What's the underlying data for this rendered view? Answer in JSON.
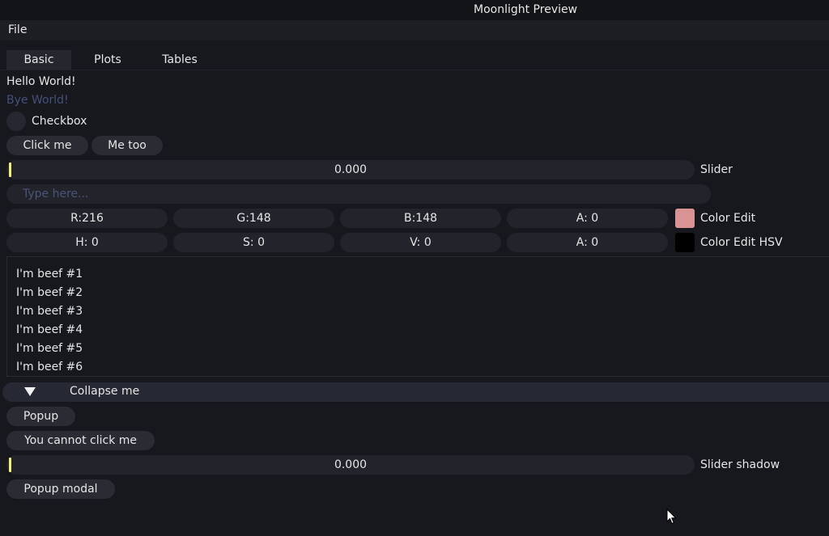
{
  "window": {
    "title": "Moonlight Preview"
  },
  "menubar": {
    "items": [
      "File"
    ]
  },
  "tabs": [
    "Basic",
    "Plots",
    "Tables"
  ],
  "basic": {
    "hello": "Hello World!",
    "bye": "Bye World!",
    "checkbox_label": "Checkbox",
    "click_me": "Click me",
    "me_too": "Me too",
    "slider_value": "0.000",
    "slider_fraction": 0,
    "slider_label": "Slider",
    "text_placeholder": "Type here...",
    "color_edit": {
      "r": "R:216",
      "g": "G:148",
      "b": "B:148",
      "a": "A:  0",
      "label": "Color Edit",
      "swatch_color": "#d89494"
    },
    "color_edit_hsv": {
      "h": "H:  0",
      "s": "S:  0",
      "v": "V:  0",
      "a": "A:  0",
      "label": "Color Edit HSV",
      "swatch_color": "#000000"
    },
    "list_items": [
      "I'm beef #1",
      "I'm beef #2",
      "I'm beef #3",
      "I'm beef #4",
      "I'm beef #5",
      "I'm beef #6"
    ],
    "collapse_label": "Collapse me",
    "popup": "Popup",
    "cannot_click": "You cannot click me",
    "slider_shadow_value": "0.000",
    "slider_shadow_fraction": 0,
    "slider_shadow_label": "Slider shadow",
    "popup_modal": "Popup modal"
  },
  "colors": {
    "accent": "#f2ef7a",
    "background": "#17181d",
    "disabled_text": "#46507a"
  }
}
